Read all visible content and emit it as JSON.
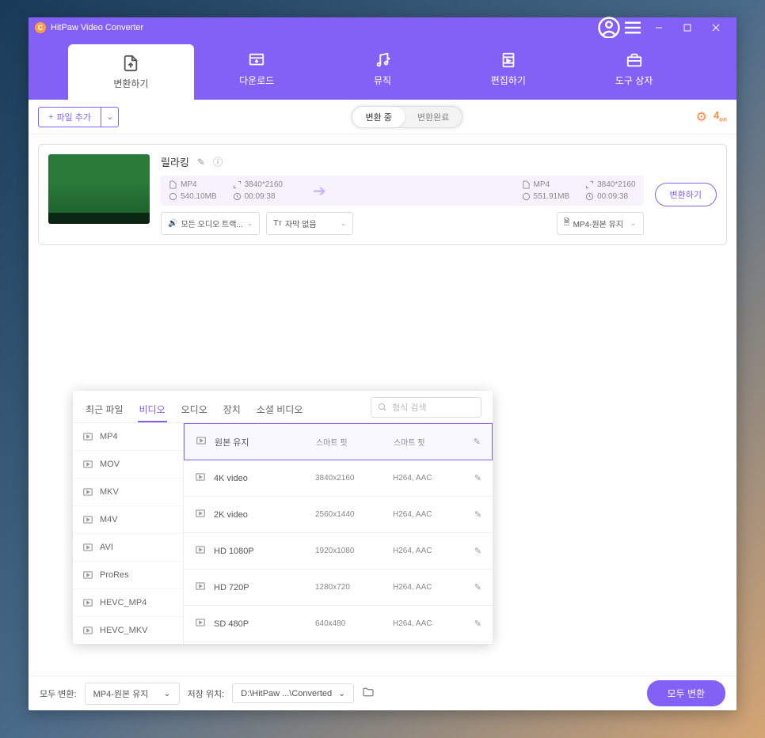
{
  "app": {
    "title": "HitPaw Video Converter"
  },
  "nav": {
    "convert": "변환하기",
    "download": "다운로드",
    "music": "뮤직",
    "edit": "편집하기",
    "toolbox": "도구 상자"
  },
  "toolbar": {
    "add_file": "파일 추가",
    "seg_converting": "변환 중",
    "seg_done": "변환완료"
  },
  "item": {
    "title": "릴라킹",
    "src": {
      "fmt": "MP4",
      "res": "3840*2160",
      "size": "540.10MB",
      "dur": "00:09:38"
    },
    "dst": {
      "fmt": "MP4",
      "res": "3840*2160",
      "size": "551.91MB",
      "dur": "00:09:38"
    },
    "audio_sel": "모든 오디오 트랙...",
    "sub_sel": "자막 없음",
    "out_sel": "MP4-원본 유지",
    "convert_btn": "변환하기"
  },
  "panel": {
    "tabs": {
      "recent": "최근 파일",
      "video": "비디오",
      "audio": "오디오",
      "device": "장치",
      "social": "소셜 비디오"
    },
    "search_ph": "형식 검색",
    "formats": [
      "MP4",
      "MOV",
      "MKV",
      "M4V",
      "AVI",
      "ProRes",
      "HEVC_MP4",
      "HEVC_MKV"
    ],
    "presets": [
      {
        "name": "원본 유지",
        "res": "스마트 핏",
        "codec": "스마트 핏"
      },
      {
        "name": "4K video",
        "res": "3840x2160",
        "codec": "H264, AAC"
      },
      {
        "name": "2K video",
        "res": "2560x1440",
        "codec": "H264, AAC"
      },
      {
        "name": "HD 1080P",
        "res": "1920x1080",
        "codec": "H264, AAC"
      },
      {
        "name": "HD 720P",
        "res": "1280x720",
        "codec": "H264, AAC"
      },
      {
        "name": "SD 480P",
        "res": "640x480",
        "codec": "H264, AAC"
      }
    ]
  },
  "footer": {
    "all_label": "모두 변환:",
    "all_sel": "MP4-원본 유지",
    "save_label": "저장 위치:",
    "save_path": "D:\\HitPaw ...\\Converted",
    "convert_all": "모두 변환"
  }
}
